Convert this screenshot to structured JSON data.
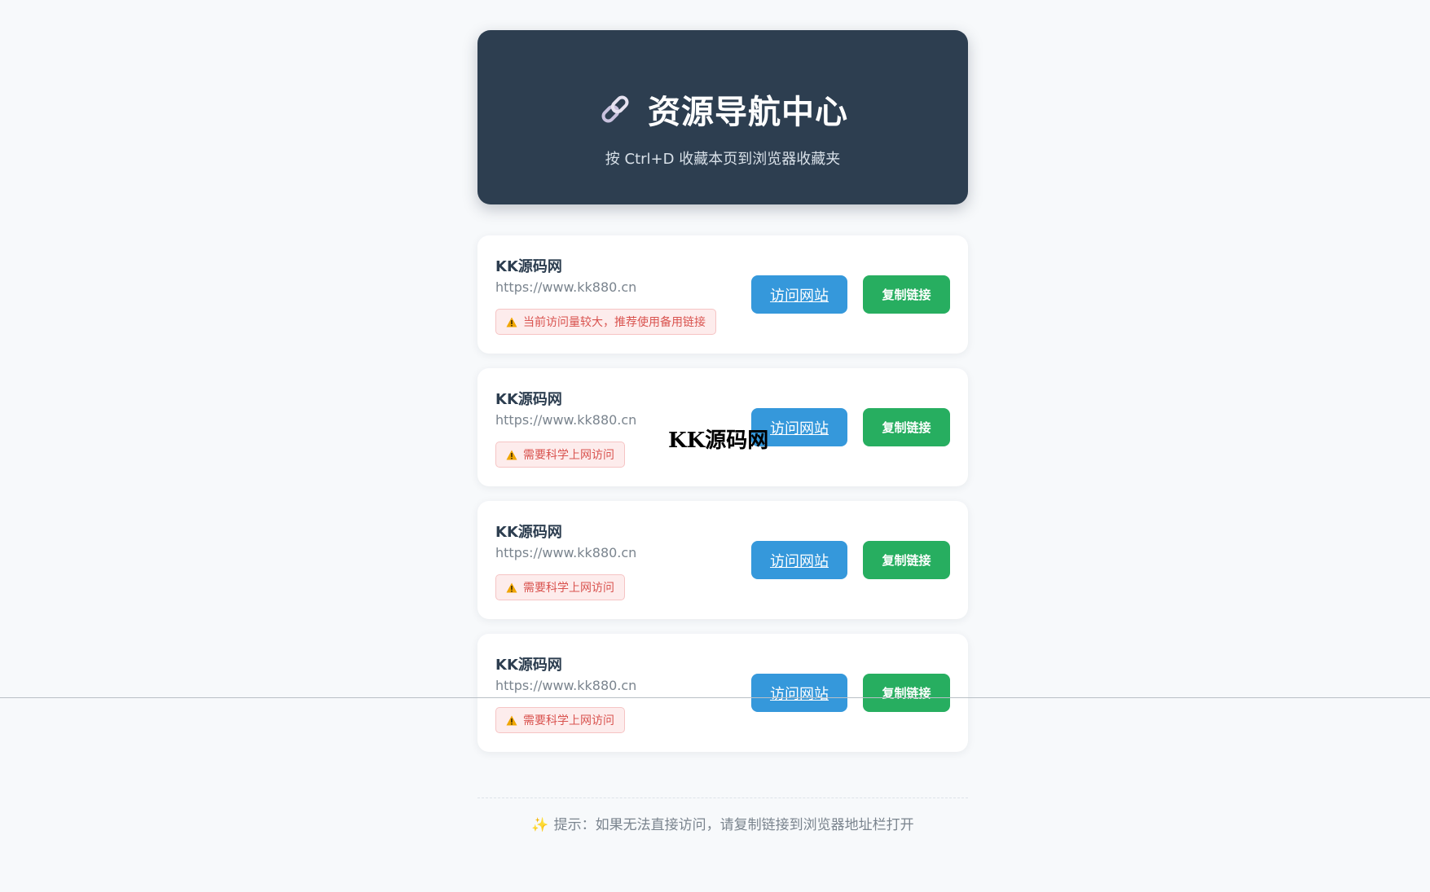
{
  "header": {
    "icon": "link-icon",
    "title": "资源导航中心",
    "subtitle": "按 Ctrl+D 收藏本页到浏览器收藏夹"
  },
  "cards": [
    {
      "name": "KK源码网",
      "url": "https://www.kk880.cn",
      "warning": "当前访问量较大，推荐使用备用链接",
      "visit_label": "访问网站",
      "copy_label": "复制链接"
    },
    {
      "name": "KK源码网",
      "url": "https://www.kk880.cn",
      "warning": "需要科学上网访问",
      "visit_label": "访问网站",
      "copy_label": "复制链接"
    },
    {
      "name": "KK源码网",
      "url": "https://www.kk880.cn",
      "warning": "需要科学上网访问",
      "visit_label": "访问网站",
      "copy_label": "复制链接"
    },
    {
      "name": "KK源码网",
      "url": "https://www.kk880.cn",
      "warning": "需要科学上网访问",
      "visit_label": "访问网站",
      "copy_label": "复制链接"
    }
  ],
  "footer": {
    "icon": "sparkle-icon",
    "tip": "提示：如果无法直接访问，请复制链接到浏览器地址栏打开"
  },
  "watermark": "KK源码网",
  "colors": {
    "header_bg": "#2d3e50",
    "visit_button": "#3598db",
    "copy_button": "#27ae60",
    "warning_text": "#d9534f",
    "page_bg": "#f7f9fb"
  }
}
